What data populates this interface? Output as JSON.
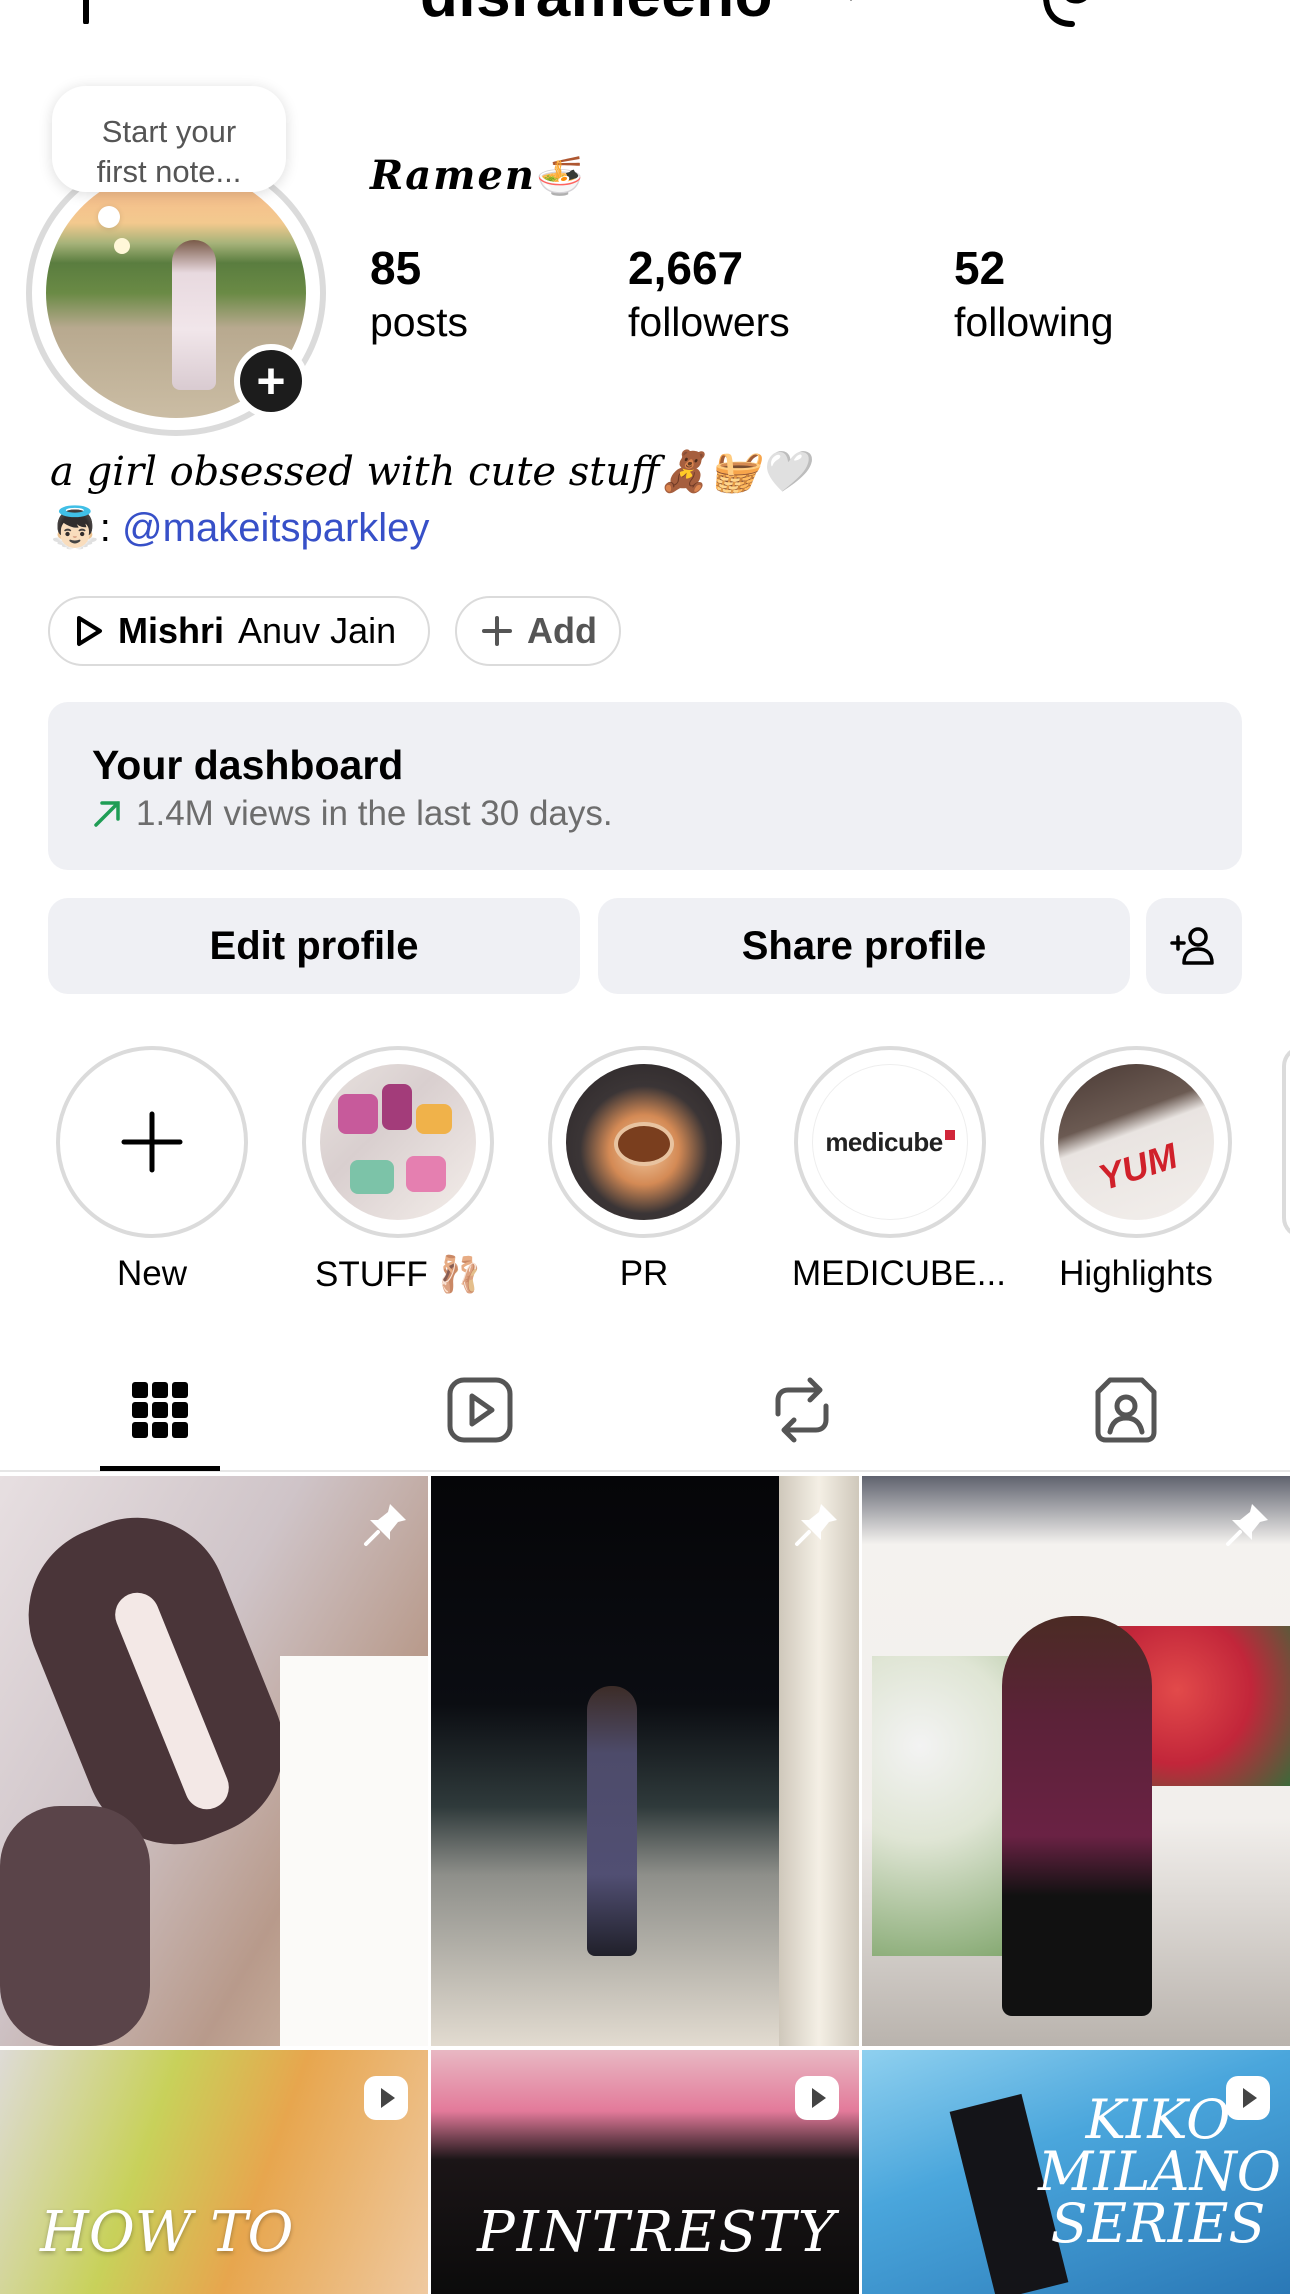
{
  "header": {
    "username": "disrameeno"
  },
  "note": {
    "placeholder_line1": "Start your",
    "placeholder_line2": "first note..."
  },
  "profile": {
    "display_name": "𝑹𝒂𝒎𝒆𝒏",
    "display_name_emoji": "🍜",
    "stats": [
      {
        "value": "85",
        "label": "posts"
      },
      {
        "value": "2,667",
        "label": "followers"
      },
      {
        "value": "52",
        "label": "following"
      }
    ],
    "bio_line1": "a girl obsessed with cute stuff🧸🧺🤍",
    "bio_line2_prefix": "👼🏻: ",
    "bio_mention": "@makeitsparkley"
  },
  "music": {
    "title": "Mishri",
    "artist": "Anuv Jain"
  },
  "add_chip": {
    "label": "Add"
  },
  "dashboard": {
    "title": "Your dashboard",
    "subtitle": "1.4M views in the last 30 days."
  },
  "actions": {
    "edit_profile": "Edit profile",
    "share_profile": "Share profile"
  },
  "highlights": [
    {
      "label": "New"
    },
    {
      "label": "STUFF 🩰"
    },
    {
      "label": "PR"
    },
    {
      "label": "MEDICUBE..."
    },
    {
      "label": "Highlights"
    }
  ],
  "highlight_texts": {
    "medicube_logo": "medicube",
    "yum_sign": "YUM"
  },
  "tabs": [
    "posts-grid",
    "reels",
    "reposts",
    "tagged"
  ],
  "posts": [
    {
      "type": "pinned",
      "caption": ""
    },
    {
      "type": "pinned",
      "caption": ""
    },
    {
      "type": "pinned",
      "caption": ""
    },
    {
      "type": "reel",
      "caption": "HOW TO"
    },
    {
      "type": "reel",
      "caption": "PINTRESTY"
    },
    {
      "type": "reel",
      "caption": "KIKO MILANO SERIES"
    }
  ],
  "colors": {
    "mention": "#3750c8",
    "trend_arrow": "#1f9d55",
    "panel": "#eff0f4",
    "ring": "#dbdbdb"
  }
}
